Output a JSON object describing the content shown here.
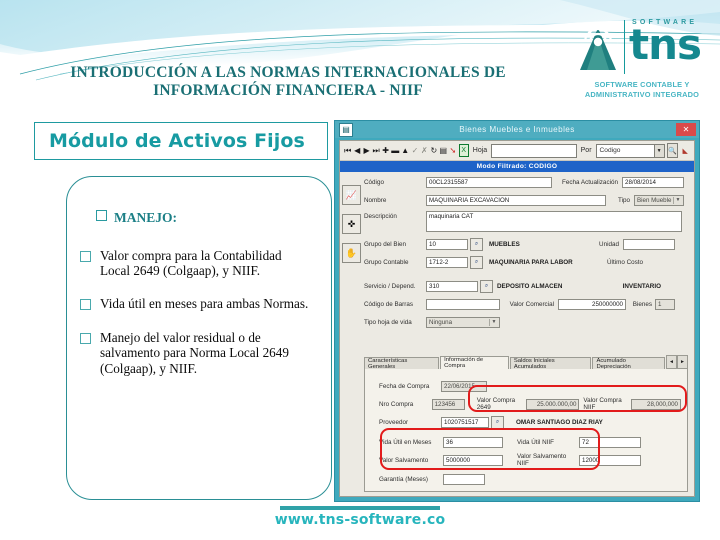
{
  "deck": {
    "title": "INTRODUCCIÓN A LAS  NORMAS INTERNACIONALES DE INFORMACIÓN FINANCIERA - NIIF",
    "footer_url": "www.tns-software.co"
  },
  "logo": {
    "word": "tns",
    "software_label": "SOFTWARE",
    "tagline_line1": "SOFTWARE CONTABLE Y",
    "tagline_line2": "ADMINISTRATIVO INTEGRADO",
    "mark_icon": "antenna-tower-icon",
    "brand_color": "#15888f",
    "tagline_color": "#49b6c4"
  },
  "left": {
    "module_title": "Módulo de Activos Fijos",
    "section_heading": "MANEJO:",
    "bullets": [
      "Valor compra para la Contabilidad Local  2649 (Colgaap), y NIIF.",
      "Vida útil en meses para ambas Normas.",
      "Manejo del valor residual o de salvamento para Norma Local 2649 (Colgaap), y NIIF."
    ],
    "accent_color": "#179ba2"
  },
  "app": {
    "window_title": "Bienes Muebles e Inmuebles",
    "window_icon": "app-form-icon",
    "close_label": "✕",
    "toolbar": {
      "nav_icons": [
        "first-record-icon",
        "previous-record-icon",
        "next-record-icon",
        "last-record-icon",
        "add-record-icon",
        "delete-record-icon",
        "edit-record-icon",
        "post-edit-icon",
        "cancel-edit-icon",
        "refresh-icon",
        "grid-icon",
        "exit-arrow-icon",
        "export-excel-icon"
      ],
      "find_label": "Hoja",
      "find_value": "",
      "by_label": "Por",
      "by_value": "Codigo",
      "search_icon": "magnifier-icon",
      "clear_icon": "eraser-icon"
    },
    "filter_bar": "Modo Filtrado: CODIGO",
    "side_buttons": [
      "chart-icon",
      "pin-icon",
      "hand-icon"
    ],
    "fields": {
      "codigo_label": "Código",
      "codigo_value": "00CL2315587",
      "fecha_act_label": "Fecha Actualización",
      "fecha_act_value": "28/08/2014",
      "nombre_label": "Nombre",
      "nombre_value": "MAQUINARIA EXCAVACION",
      "tipo_label": "Tipo",
      "tipo_value": "Bien Mueble",
      "descripcion_label": "Descripción",
      "descripcion_value": "maquinaria CAT",
      "grupo_bien_label": "Grupo del Bien",
      "grupo_bien_value": "10",
      "grupo_bien_desc": "MUEBLES",
      "unidad_label": "Unidad",
      "unidad_value": "",
      "grupo_contable_label": "Grupo Contable",
      "grupo_contable_value": "1712-2",
      "grupo_contable_desc": "MAQUINARIA PARA LABOR",
      "ultimo_costo_label": "Último Costo",
      "servicio_label": "Servicio / Depend.",
      "servicio_value": "310",
      "servicio_desc": "DEPOSITO ALMACEN",
      "inventario_label": "INVENTARIO",
      "codigo_barras_label": "Código de Barras",
      "codigo_barras_value": "",
      "valor_comercial_label": "Valor Comercial",
      "valor_comercial_value": "250000000",
      "bienes_label": "Bienes",
      "bienes_value": "1",
      "tipo_hoja_label": "Tipo hoja de vida",
      "tipo_hoja_value": "Ninguna"
    },
    "tabs": [
      {
        "label": "Características Generales",
        "active": false
      },
      {
        "label": "Información de Compra",
        "active": true
      },
      {
        "label": "Saldos Iniciales Acumulados",
        "active": false
      },
      {
        "label": "Acumulado Depreciación",
        "active": false
      }
    ],
    "tab_scroll_left": "◄",
    "tab_scroll_right": "►",
    "compra": {
      "fecha_label": "Fecha de Compra",
      "fecha_value": "22/06/2015",
      "nro_label": "Nro Compra",
      "nro_value": "123456",
      "valor_2649_label": "Valor Compra 2649",
      "valor_2649_value": "25.000.000,00",
      "valor_niif_label": "Valor Compra NIIF",
      "valor_niif_value": "28,000,000",
      "proveedor_label": "Proveedor",
      "proveedor_value": "1020751517",
      "proveedor_nombre": "OMAR SANTIAGO DIAZ RIAY",
      "vida_util_label": "Vida Útil en Meses",
      "vida_util_value": "36",
      "vida_util_niif_label": "Vida Útil NIIF",
      "vida_util_niif_value": "72",
      "salvamento_label": "Valor Salvamento",
      "salvamento_value": "5000000",
      "salvamento_niif_label": "Valor Salvamento NIIF",
      "salvamento_niif_value": "12000",
      "garantia_label": "Garantía  (Meses)",
      "garantia_value": ""
    },
    "highlight_color": "#e21b1b"
  }
}
